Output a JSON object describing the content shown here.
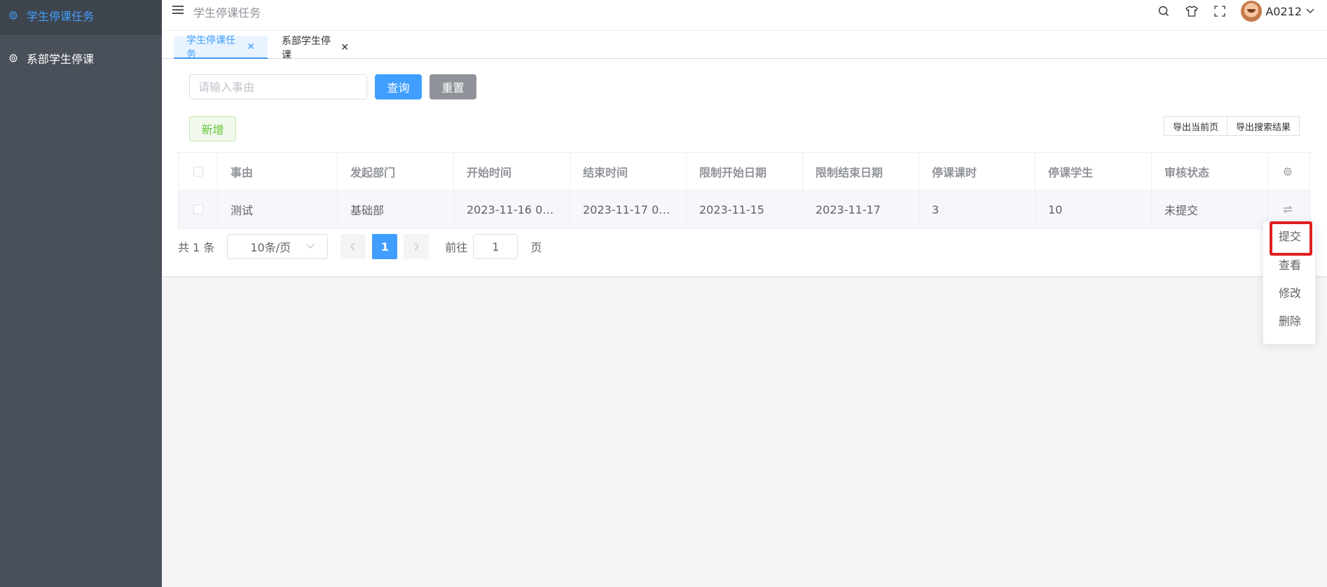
{
  "sidebar": {
    "items": [
      {
        "label": "学生停课任务",
        "icon": "gear-icon",
        "active": true
      },
      {
        "label": "系部学生停课",
        "icon": "gear-icon",
        "active": false
      }
    ]
  },
  "header": {
    "breadcrumb": "学生停课任务",
    "username": "A0212",
    "icons": [
      "search-icon",
      "shirt-icon",
      "fullscreen-icon",
      "chevron-down-icon"
    ]
  },
  "tabs": [
    {
      "label": "学生停课任务",
      "active": true
    },
    {
      "label": "系部学生停课",
      "active": false
    }
  ],
  "search": {
    "placeholder": "请输入事由",
    "query_label": "查询",
    "reset_label": "重置"
  },
  "toolbar": {
    "add_label": "新增",
    "export_page_label": "导出当前页",
    "export_search_label": "导出搜索结果"
  },
  "table": {
    "columns": [
      "事由",
      "发起部门",
      "开始时间",
      "结束时间",
      "限制开始日期",
      "限制结束日期",
      "停课课时",
      "停课学生",
      "审核状态"
    ],
    "rows": [
      {
        "cause": "测试",
        "dept": "基础部",
        "start": "2023-11-16 00:...",
        "end": "2023-11-17 00:...",
        "limit_start": "2023-11-15",
        "limit_end": "2023-11-17",
        "hours": "3",
        "students": "10",
        "status": "未提交"
      }
    ]
  },
  "pagination": {
    "total_text": "共 1 条",
    "page_size": "10条/页",
    "current_page": "1",
    "goto_label": "前往",
    "goto_value": "1",
    "page_suffix": "页"
  },
  "dropdown": {
    "items": [
      "提交",
      "查看",
      "修改",
      "删除"
    ],
    "highlighted": "提交"
  },
  "colors": {
    "primary": "#409eff",
    "sidebar_bg": "#4a5059",
    "highlight_border": "#e02020",
    "success": "#67c23a"
  }
}
